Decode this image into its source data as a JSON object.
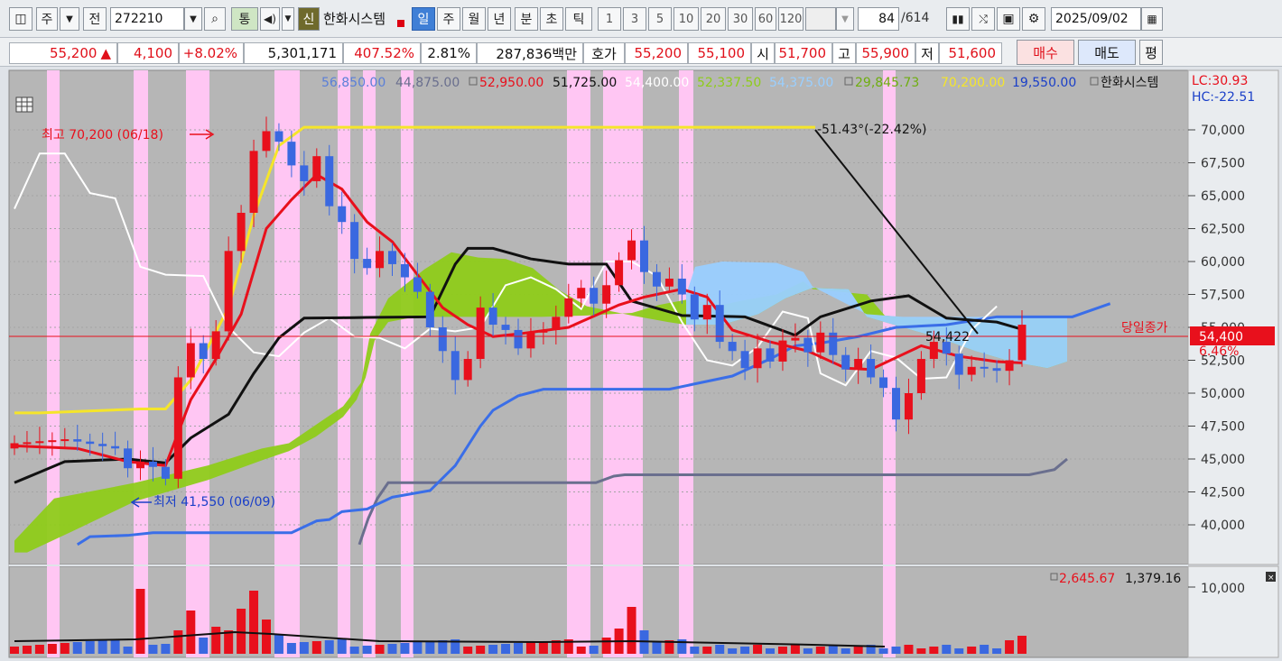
{
  "toolbar": {
    "period_label": "주",
    "prev_label": "전",
    "stock_code": "272210",
    "tong_label": "통",
    "sin_label": "신",
    "stock_name": "한화시스템",
    "periods": [
      "일",
      "주",
      "월",
      "년",
      "분",
      "초",
      "틱"
    ],
    "selected_period": "일",
    "intervals": [
      "1",
      "3",
      "5",
      "10",
      "20",
      "30",
      "60",
      "120"
    ],
    "count_value": "84",
    "count_total": "/614",
    "date": "2025/09/02"
  },
  "quote": {
    "price": "55,200",
    "change_arrow": "▲",
    "change": "4,100",
    "change_pct": "+8.02%",
    "volume": "5,301,171",
    "vol_ratio": "407.52%",
    "turnover": "2.81%",
    "amount": "287,836백만",
    "bid_label": "호가",
    "ask_price": "55,200",
    "bid_price": "55,100",
    "open_label": "시",
    "open": "51,700",
    "high_label": "고",
    "high": "55,900",
    "low_label": "저",
    "low": "51,600",
    "buy_label": "매수",
    "sell_label": "매도",
    "eval_label": "평"
  },
  "legend": {
    "v1": "56,850.00",
    "v2": "44,875.00",
    "v3": "52,950.00",
    "v4": "51,725.00",
    "v5": "54,400.00",
    "v6": "52,337.50",
    "v7": "54,375.00",
    "v8": "29,845.73",
    "v9": "70,200.00",
    "v10": "19,550.00",
    "name": "한화시스템",
    "lc": "LC:30.93",
    "hc": "HC:-22.51"
  },
  "annotations": {
    "high_label": "최고 70,200 (06/18)",
    "low_label": "최저 41,550 (06/09)",
    "trend_label": "-51.43°(-22.42%)",
    "trend_value": "54,422",
    "today_close_label": "당일종가",
    "current_price_tag": "54,400",
    "current_pct_tag": "6.46%"
  },
  "volume_panel": {
    "legend1": "2,645.67",
    "legend2": "1,379.16",
    "axis_label": "10,000"
  },
  "colors": {
    "up": "#e8101c",
    "down": "#3a68e0",
    "highlight": "#ffc6f3",
    "cloud": "#8fcc1a",
    "cloud_alt": "#9acfff"
  },
  "chart_data": {
    "type": "candlestick",
    "ylim": [
      37500,
      72500
    ],
    "y_ticks": [
      "70,000",
      "67,500",
      "65,000",
      "62,500",
      "60,000",
      "57,500",
      "55,000",
      "52,500",
      "50,000",
      "47,500",
      "45,000",
      "42,500",
      "40,000"
    ],
    "y_tick_values": [
      70000,
      67500,
      65000,
      62500,
      60000,
      57500,
      55000,
      52500,
      50000,
      47500,
      45000,
      42500,
      40000
    ]
  }
}
